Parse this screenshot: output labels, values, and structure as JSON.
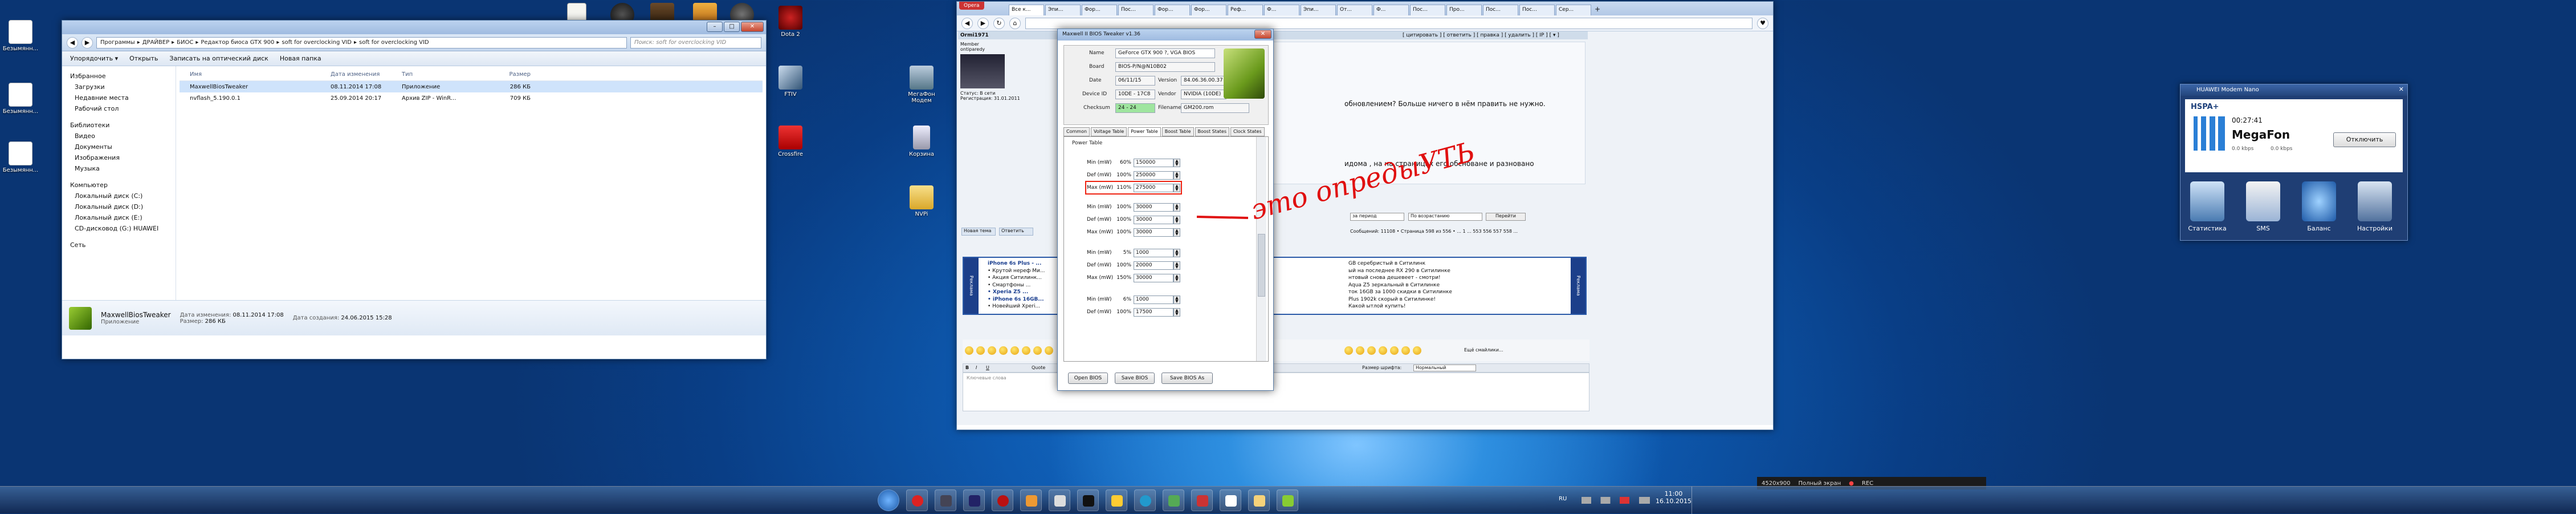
{
  "desktop": {
    "left_icons": [
      {
        "label": "Безымянн..."
      },
      {
        "label": "Безымянн..."
      },
      {
        "label": "Безымянн..."
      }
    ],
    "top_icons": [
      "",
      "",
      "",
      "",
      ""
    ],
    "right_icons": [
      {
        "label": "Dota 2"
      },
      {
        "label": "FTIV"
      },
      {
        "label": "Crossfire"
      }
    ],
    "mid_icons": [
      {
        "label": "МегаФон Модем"
      },
      {
        "label": "Корзина"
      },
      {
        "label": "NVPi"
      }
    ]
  },
  "explorer": {
    "breadcrumb": [
      "Программы",
      "ДРАЙВЕР",
      "БИОС",
      "Редактор биоса GTX 900",
      "soft for overclocking VID",
      "soft for overclocking VID"
    ],
    "search_placeholder": "Поиск: soft for overclocking VID",
    "toolbar": {
      "organize": "Упорядочить ▾",
      "open": "Открыть",
      "burn": "Записать на оптический диск",
      "new_folder": "Новая папка"
    },
    "sidebar": {
      "favorites": "Избранное",
      "favorites_items": [
        "Загрузки",
        "Недавние места",
        "Рабочий стол"
      ],
      "libraries": "Библиотеки",
      "libraries_items": [
        "Видео",
        "Документы",
        "Изображения",
        "Музыка"
      ],
      "computer": "Компьютер",
      "computer_items": [
        "Локальный диск (C:)",
        "Локальный диск (D:)",
        "Локальный диск (E:)",
        "CD-дисковод (G:) HUAWEI"
      ],
      "network": "Сеть"
    },
    "columns": [
      "Имя",
      "Дата изменения",
      "Тип",
      "Размер"
    ],
    "files": [
      {
        "name": "MaxwellBiosTweaker",
        "date": "08.11.2014 17:08",
        "type": "Приложение",
        "size": "286 КБ"
      },
      {
        "name": "nvflash_5.190.0.1",
        "date": "25.09.2014 20:17",
        "type": "Архив ZIP - WinR...",
        "size": "709 КБ"
      }
    ],
    "details": {
      "name": "MaxwellBiosTweaker",
      "kind": "Приложение",
      "modified_label": "Дата изменения:",
      "modified": "08.11.2014 17:08",
      "created_label": "Дата создания:",
      "created": "24.06.2015 15:28",
      "size_label": "Размер:",
      "size": "286 КБ"
    }
  },
  "browser": {
    "menu_label": "Opera",
    "tabs": [
      "Все к...",
      "Эпи...",
      "Фор...",
      "Пос...",
      "Фор...",
      "Фор...",
      "Реф...",
      "Ф...",
      "Эпи...",
      "От...",
      "Ф...",
      "Пос...",
      "Про...",
      "Пос...",
      "Пос...",
      "Сер..."
    ],
    "forum": {
      "user": "Ormi1971",
      "role_a": "Member",
      "role_b": "ontiparedy",
      "status": "Статус: В сети",
      "registered": "Регистрация: 31.01.2011",
      "header_links": "[ цитировать ] [ ответить ] [ правка ] [ удалить ] [ IP ] [ ▾ ]",
      "post_text": "обновлением? Больше ничего в нём править не нужно.",
      "post_text2": "идома , на на страницах его обсноване и разновано",
      "filter_a": "за период",
      "filter_b": "По возрастанию",
      "go": "Перейти",
      "pages": "Сообщений: 11108 • Страница 598 из 556 • ... 1 ... 553 556 557 558 ...",
      "reply": "Новая тема",
      "reply2": "Ответить",
      "ad_side": "Реклама",
      "ad_lines": [
        "iPhone 6s Plus - ...",
        "• Крутой нереф Ми...",
        "• Акция Ситилинк...",
        "• Смартфоны ...",
        "• Xperia Z5 ...",
        "• iPhone 6s 16GB...",
        "• Новейший Xperi..."
      ],
      "ad_right": [
        "GB серебристый в Ситилинк",
        "ый на последнее RX 290 в Ситилинке",
        "нтовый снова дешевеет - смотри!",
        "Aqua Z5 зеркальный в Ситилинке",
        "ток 16GB за 1000 скидки в Ситилинке",
        "Plus 1902k скорый в Ситилинке!",
        "Какой ытлой купить!"
      ],
      "editor_font": "Нормальный",
      "editor_label": "Размер шрифта:",
      "editor_hint": "Ещё смайлики...",
      "quote": "Quote",
      "small_text": "Ключевые слова"
    }
  },
  "bios_tweaker": {
    "title": "Maxwell II BIOS Tweaker v1.36",
    "fields": {
      "name_label": "Name",
      "name": "GeForce GTX 900 ?, VGA BIOS",
      "board_label": "Board",
      "board": "BIOS-P/N@N10B02",
      "date_label": "Date",
      "date": "06/11/15",
      "version_label": "Version",
      "version": "84.06.36.00.37",
      "device_label": "Device ID",
      "device": "10DE - 17C8",
      "vendor_label": "Vendor",
      "vendor": "NVIDIA (10DE)",
      "checksum_label": "Checksum",
      "checksum": "24 - 24",
      "filename_label": "Filename",
      "filename": "GM200.rom"
    },
    "tabs": [
      "Common",
      "Voltage Table",
      "Power Table",
      "Boost Table",
      "Boost States",
      "Clock States"
    ],
    "section": "Power Table",
    "rows": [
      {
        "label": "Min (mW)",
        "pct": "60%",
        "value": "150000"
      },
      {
        "label": "Def (mW)",
        "pct": "100%",
        "value": "250000"
      },
      {
        "label": "Max (mW)",
        "pct": "110%",
        "value": "275000"
      },
      {
        "label": "Min (mW)",
        "pct": "100%",
        "value": "30000"
      },
      {
        "label": "Def (mW)",
        "pct": "100%",
        "value": "30000"
      },
      {
        "label": "Max (mW)",
        "pct": "100%",
        "value": "30000"
      },
      {
        "label": "Min (mW)",
        "pct": "5%",
        "value": "1000"
      },
      {
        "label": "Def (mW)",
        "pct": "100%",
        "value": "20000"
      },
      {
        "label": "Max (mW)",
        "pct": "150%",
        "value": "30000"
      },
      {
        "label": "Min (mW)",
        "pct": "6%",
        "value": "1000"
      },
      {
        "label": "Def (mW)",
        "pct": "100%",
        "value": "17500"
      }
    ],
    "buttons": {
      "open": "Open BIOS",
      "save": "Save BIOS",
      "save_as": "Save BIOS As"
    }
  },
  "annotation": {
    "text": "это опредыУТЬ"
  },
  "modem": {
    "title": "HUAWEI Modem Nano",
    "network": "HSPA+",
    "time": "00:27:41",
    "operator": "MegaFon",
    "speed_down": "0.0 kbps",
    "speed_up": "0.0 kbps",
    "disconnect": "Отключить",
    "tools": [
      "Статистика",
      "SMS",
      "Баланс",
      "Настройки"
    ]
  },
  "recorder": {
    "res": "4520x900",
    "mode": "Полный экран",
    "rec": "REC"
  },
  "tray": {
    "lang": "RU",
    "time": "11:00",
    "date": "16.10.2015"
  }
}
